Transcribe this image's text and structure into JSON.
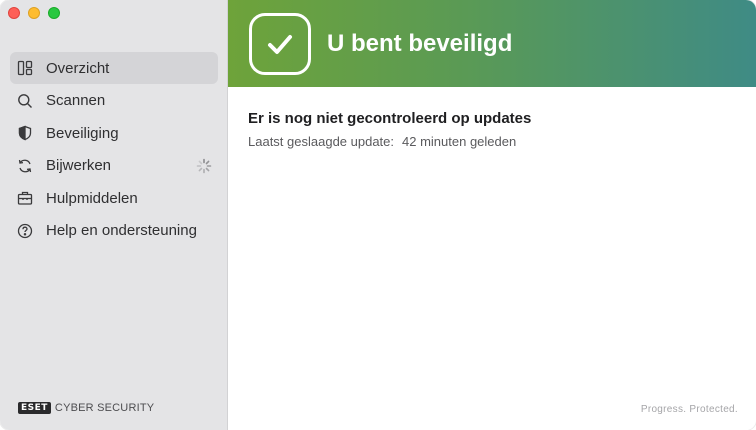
{
  "sidebar": {
    "items": [
      {
        "label": "Overzicht",
        "icon": "dashboard-icon",
        "active": true
      },
      {
        "label": "Scannen",
        "icon": "search-icon",
        "active": false
      },
      {
        "label": "Beveiliging",
        "icon": "shield-icon",
        "active": false
      },
      {
        "label": "Bijwerken",
        "icon": "refresh-icon",
        "active": false
      },
      {
        "label": "Hulpmiddelen",
        "icon": "briefcase-icon",
        "active": false
      },
      {
        "label": "Help en ondersteuning",
        "icon": "help-icon",
        "active": false
      }
    ],
    "brand_logo": "ESET",
    "brand_text": "CYBER SECURITY"
  },
  "banner": {
    "title": "U bent beveiligd",
    "colors": {
      "start": "#6ea33a",
      "end": "#3f8b85"
    }
  },
  "main": {
    "update_title": "Er is nog niet gecontroleerd op updates",
    "update_label": "Laatst geslaagde update:",
    "update_value": "42 minuten geleden",
    "tagline": "Progress. Protected."
  }
}
